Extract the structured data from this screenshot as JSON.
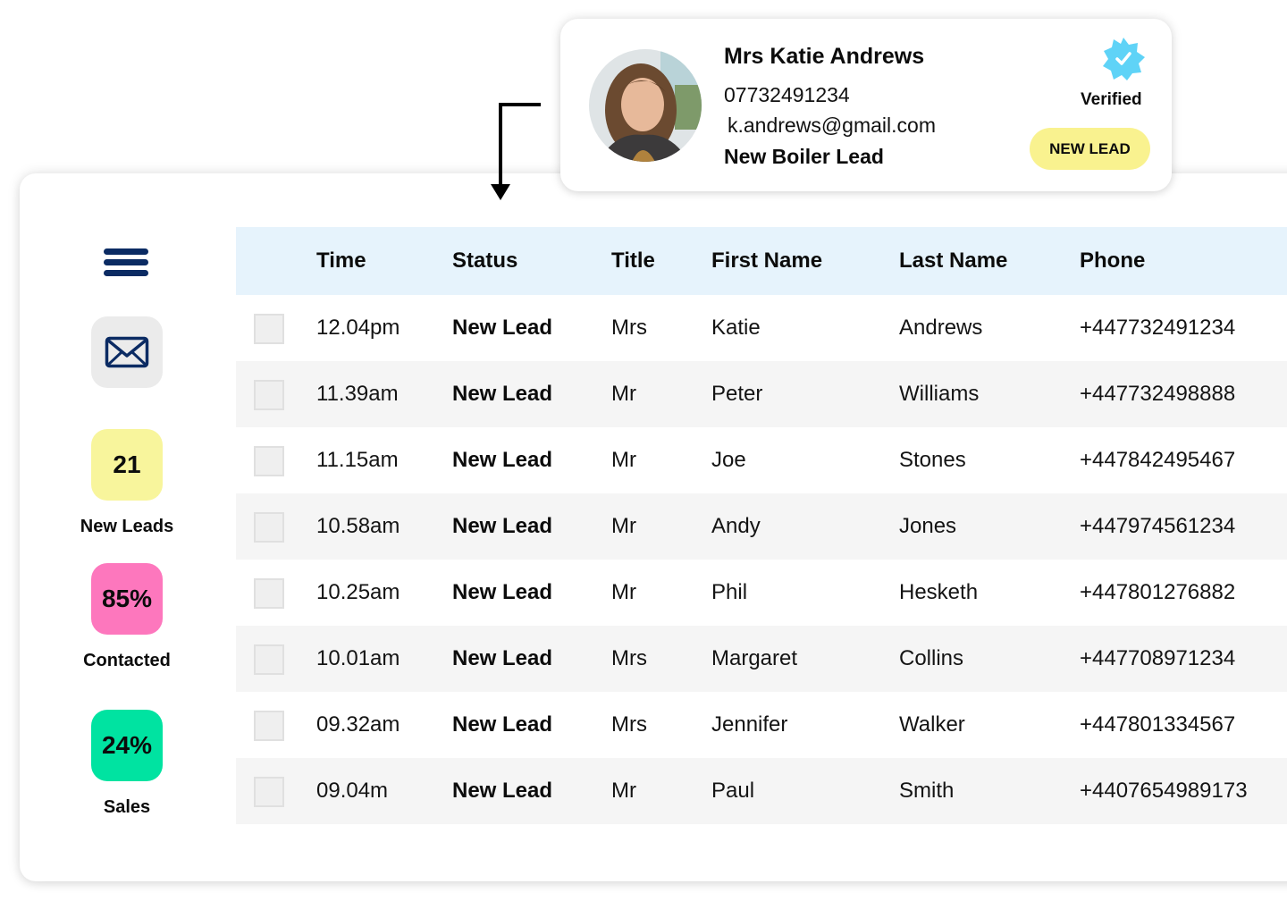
{
  "lead_card": {
    "name": "Mrs Katie Andrews",
    "phone": "07732491234",
    "email": "k.andrews@gmail.com",
    "lead_type": "New Boiler Lead",
    "verified_label": "Verified",
    "verified_icon": "verified-badge-icon",
    "badge_label": "NEW LEAD",
    "colors": {
      "verified": "#5fd3f7",
      "badge_bg": "#f9f28f"
    }
  },
  "sidebar": {
    "menu_icon": "hamburger-menu-icon",
    "mail_icon": "envelope-icon",
    "stats": [
      {
        "value": "21",
        "label": "New Leads",
        "color": "#f8f59c"
      },
      {
        "value": "85%",
        "label": "Contacted",
        "color": "#fd77bd"
      },
      {
        "value": "24%",
        "label": "Sales",
        "color": "#00e3a1"
      }
    ]
  },
  "table": {
    "columns": [
      "Time",
      "Status",
      "Title",
      "First Name",
      "Last Name",
      "Phone"
    ],
    "rows": [
      {
        "time": "12.04pm",
        "status": "New Lead",
        "title": "Mrs",
        "first": "Katie",
        "last": "Andrews",
        "phone": "+447732491234"
      },
      {
        "time": "11.39am",
        "status": "New Lead",
        "title": "Mr",
        "first": "Peter",
        "last": "Williams",
        "phone": "+447732498888"
      },
      {
        "time": "11.15am",
        "status": "New Lead",
        "title": "Mr",
        "first": "Joe",
        "last": "Stones",
        "phone": "+447842495467"
      },
      {
        "time": "10.58am",
        "status": "New Lead",
        "title": "Mr",
        "first": "Andy",
        "last": "Jones",
        "phone": "+447974561234"
      },
      {
        "time": "10.25am",
        "status": "New Lead",
        "title": "Mr",
        "first": "Phil",
        "last": "Hesketh",
        "phone": "+447801276882"
      },
      {
        "time": "10.01am",
        "status": "New Lead",
        "title": "Mrs",
        "first": "Margaret",
        "last": "Collins",
        "phone": "+447708971234"
      },
      {
        "time": "09.32am",
        "status": "New Lead",
        "title": "Mrs",
        "first": "Jennifer",
        "last": "Walker",
        "phone": "+447801334567"
      },
      {
        "time": "09.04m",
        "status": "New Lead",
        "title": "Mr",
        "first": "Paul",
        "last": "Smith",
        "phone": "+4407654989173"
      }
    ],
    "colors": {
      "header_bg": "#e6f3fc",
      "alt_row_bg": "#f5f5f5"
    }
  }
}
